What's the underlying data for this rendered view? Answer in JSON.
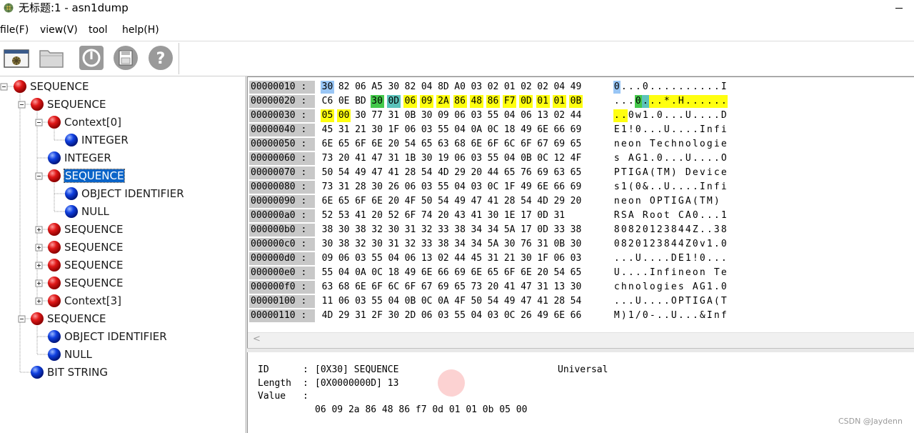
{
  "window": {
    "title": "无标题:1 - asn1dump"
  },
  "menu": [
    "file(F)",
    "view(V)",
    "tool",
    "help(H)"
  ],
  "toolbar": {
    "buttons": [
      {
        "name": "new-window",
        "icon": "app-window-icon"
      },
      {
        "name": "open",
        "icon": "folder-icon"
      },
      {
        "name": "power",
        "icon": "power-icon"
      },
      {
        "name": "save",
        "icon": "disk-icon"
      },
      {
        "name": "help",
        "icon": "question-icon"
      }
    ]
  },
  "tree": [
    {
      "label": "SEQUENCE",
      "depth": 0,
      "color": "red",
      "expander": "minus"
    },
    {
      "label": "SEQUENCE",
      "depth": 1,
      "color": "red",
      "expander": "minus"
    },
    {
      "label": "Context[0]",
      "depth": 2,
      "color": "red",
      "expander": "minus"
    },
    {
      "label": "INTEGER",
      "depth": 3,
      "color": "blue",
      "expander": "none"
    },
    {
      "label": "INTEGER",
      "depth": 2,
      "color": "blue",
      "expander": "none"
    },
    {
      "label": "SEQUENCE",
      "depth": 2,
      "color": "red",
      "expander": "minus",
      "selected": true
    },
    {
      "label": "OBJECT IDENTIFIER",
      "depth": 3,
      "color": "blue",
      "expander": "none"
    },
    {
      "label": "NULL",
      "depth": 3,
      "color": "blue",
      "expander": "none"
    },
    {
      "label": "SEQUENCE",
      "depth": 2,
      "color": "red",
      "expander": "plus"
    },
    {
      "label": "SEQUENCE",
      "depth": 2,
      "color": "red",
      "expander": "plus"
    },
    {
      "label": "SEQUENCE",
      "depth": 2,
      "color": "red",
      "expander": "plus"
    },
    {
      "label": "SEQUENCE",
      "depth": 2,
      "color": "red",
      "expander": "plus"
    },
    {
      "label": "Context[3]",
      "depth": 2,
      "color": "red",
      "expander": "plus"
    },
    {
      "label": "SEQUENCE",
      "depth": 1,
      "color": "red",
      "expander": "minus"
    },
    {
      "label": "OBJECT IDENTIFIER",
      "depth": 2,
      "color": "blue",
      "expander": "none"
    },
    {
      "label": "NULL",
      "depth": 2,
      "color": "blue",
      "expander": "none"
    },
    {
      "label": "BIT STRING",
      "depth": 1,
      "color": "blue",
      "expander": "none"
    }
  ],
  "hex": {
    "rows": [
      {
        "addr": "00000010 :",
        "bytes": [
          "30",
          "82",
          "06",
          "A5",
          "30",
          "82",
          "04",
          "8D",
          "A0",
          "03",
          "02",
          "01",
          "02",
          "02",
          "04",
          "49"
        ],
        "ascii": "0...0..........I"
      },
      {
        "addr": "00000020 :",
        "bytes": [
          "C6",
          "0E",
          "BD",
          "30",
          "0D",
          "06",
          "09",
          "2A",
          "86",
          "48",
          "86",
          "F7",
          "0D",
          "01",
          "01",
          "0B"
        ],
        "ascii": "...0...*.H......"
      },
      {
        "addr": "00000030 :",
        "bytes": [
          "05",
          "00",
          "30",
          "77",
          "31",
          "0B",
          "30",
          "09",
          "06",
          "03",
          "55",
          "04",
          "06",
          "13",
          "02",
          "44"
        ],
        "ascii": "..0w1.0...U....D"
      },
      {
        "addr": "00000040 :",
        "bytes": [
          "45",
          "31",
          "21",
          "30",
          "1F",
          "06",
          "03",
          "55",
          "04",
          "0A",
          "0C",
          "18",
          "49",
          "6E",
          "66",
          "69"
        ],
        "ascii": "E1!0...U....Infi"
      },
      {
        "addr": "00000050 :",
        "bytes": [
          "6E",
          "65",
          "6F",
          "6E",
          "20",
          "54",
          "65",
          "63",
          "68",
          "6E",
          "6F",
          "6C",
          "6F",
          "67",
          "69",
          "65"
        ],
        "ascii": "neon Technologie"
      },
      {
        "addr": "00000060 :",
        "bytes": [
          "73",
          "20",
          "41",
          "47",
          "31",
          "1B",
          "30",
          "19",
          "06",
          "03",
          "55",
          "04",
          "0B",
          "0C",
          "12",
          "4F"
        ],
        "ascii": "s AG1.0...U....O"
      },
      {
        "addr": "00000070 :",
        "bytes": [
          "50",
          "54",
          "49",
          "47",
          "41",
          "28",
          "54",
          "4D",
          "29",
          "20",
          "44",
          "65",
          "76",
          "69",
          "63",
          "65"
        ],
        "ascii": "PTIGA(TM) Device"
      },
      {
        "addr": "00000080 :",
        "bytes": [
          "73",
          "31",
          "28",
          "30",
          "26",
          "06",
          "03",
          "55",
          "04",
          "03",
          "0C",
          "1F",
          "49",
          "6E",
          "66",
          "69"
        ],
        "ascii": "s1(0&..U....Infi"
      },
      {
        "addr": "00000090 :",
        "bytes": [
          "6E",
          "65",
          "6F",
          "6E",
          "20",
          "4F",
          "50",
          "54",
          "49",
          "47",
          "41",
          "28",
          "54",
          "4D",
          "29",
          "20"
        ],
        "ascii": "neon OPTIGA(TM) "
      },
      {
        "addr": "000000a0 :",
        "bytes": [
          "52",
          "53",
          "41",
          "20",
          "52",
          "6F",
          "74",
          "20",
          "43",
          "41",
          "30",
          "1E",
          "17",
          "0D",
          "31"
        ],
        "ascii": "RSA Root CA0...1"
      },
      {
        "addr": "000000b0 :",
        "bytes": [
          "38",
          "30",
          "38",
          "32",
          "30",
          "31",
          "32",
          "33",
          "38",
          "34",
          "34",
          "5A",
          "17",
          "0D",
          "33",
          "38"
        ],
        "ascii": "80820123844Z..38"
      },
      {
        "addr": "000000c0 :",
        "bytes": [
          "30",
          "38",
          "32",
          "30",
          "31",
          "32",
          "33",
          "38",
          "34",
          "34",
          "5A",
          "30",
          "76",
          "31",
          "0B",
          "30"
        ],
        "ascii": "0820123844Z0v1.0"
      },
      {
        "addr": "000000d0 :",
        "bytes": [
          "09",
          "06",
          "03",
          "55",
          "04",
          "06",
          "13",
          "02",
          "44",
          "45",
          "31",
          "21",
          "30",
          "1F",
          "06",
          "03"
        ],
        "ascii": "...U....DE1!0..."
      },
      {
        "addr": "000000e0 :",
        "bytes": [
          "55",
          "04",
          "0A",
          "0C",
          "18",
          "49",
          "6E",
          "66",
          "69",
          "6E",
          "65",
          "6F",
          "6E",
          "20",
          "54",
          "65"
        ],
        "ascii": "U....Infineon Te"
      },
      {
        "addr": "000000f0 :",
        "bytes": [
          "63",
          "68",
          "6E",
          "6F",
          "6C",
          "6F",
          "67",
          "69",
          "65",
          "73",
          "20",
          "41",
          "47",
          "31",
          "13",
          "30"
        ],
        "ascii": "chnologies AG1.0"
      },
      {
        "addr": "00000100 :",
        "bytes": [
          "11",
          "06",
          "03",
          "55",
          "04",
          "0B",
          "0C",
          "0A",
          "4F",
          "50",
          "54",
          "49",
          "47",
          "41",
          "28",
          "54"
        ],
        "ascii": "...U....OPTIGA(T"
      },
      {
        "addr": "00000110 :",
        "bytes": [
          "4D",
          "29",
          "31",
          "2F",
          "30",
          "2D",
          "06",
          "03",
          "55",
          "04",
          "03",
          "0C",
          "26",
          "49",
          "6E",
          "66"
        ],
        "ascii": "M)1/0-..U...&Inf"
      }
    ],
    "highlights": [
      {
        "row": 0,
        "from": 0,
        "to": 0,
        "color": "#99c6f5",
        "ascii_from": 0,
        "ascii_to": 0
      },
      {
        "row": 1,
        "from": 3,
        "to": 3,
        "color": "#44c94a",
        "ascii_from": 3,
        "ascii_to": 3
      },
      {
        "row": 1,
        "from": 4,
        "to": 4,
        "color": "#5cc3bb",
        "ascii_from": 4,
        "ascii_to": 4
      },
      {
        "row": 1,
        "from": 5,
        "to": 15,
        "color": "#ffff10",
        "ascii_from": 5,
        "ascii_to": 15
      },
      {
        "row": 2,
        "from": 0,
        "to": 1,
        "color": "#ffff10",
        "ascii_from": 0,
        "ascii_to": 1
      }
    ],
    "scroll_arrow": "<"
  },
  "info": {
    "id_label": "ID",
    "id_value": "[0X30] SEQUENCE",
    "class_value": "Universal",
    "length_label": "Length",
    "length_value": "[0X0000000D] 13",
    "value_label": "Value",
    "value_bytes": "06 09 2a 86 48 86 f7 0d 01 01 0b 05 00"
  },
  "watermark": "CSDN @Jaydenn"
}
